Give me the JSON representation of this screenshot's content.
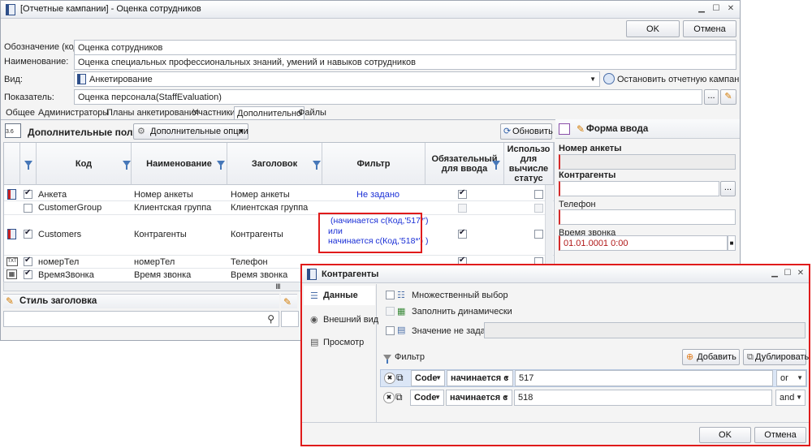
{
  "window": {
    "title": "[Отчетные кампании] - Оценка сотрудников",
    "ok": "OK",
    "cancel": "Отмена"
  },
  "form": {
    "code_label": "Обозначение (код):",
    "code_value": "Оценка сотрудников",
    "name_label": "Наименование:",
    "name_value": "Оценка специальных профессиональных знаний, умений и навыков сотрудников",
    "type_label": "Вид:",
    "type_value": "Анкетирование",
    "stop_label": "Остановить отчетную кампанию",
    "indicator_label": "Показатель:",
    "indicator_value": "Оценка персонала(StaffEvaluation)",
    "indicator_btn": "..."
  },
  "tabs": [
    "Общее",
    "Администраторы",
    "Планы анкетирования",
    "Участники",
    "Дополнительно",
    "Файлы"
  ],
  "fields_panel": {
    "title": "Дополнительные поля",
    "options": "Дополнительные опции",
    "refresh": "Обновить",
    "columns": [
      "Код",
      "Наименование",
      "Заголовок",
      "Фильтр",
      "Обязательный для ввода",
      "Использо для вычисле статус"
    ],
    "rows": [
      {
        "code": "Анкета",
        "name": "Номер анкеты",
        "caption": "Номер анкеты",
        "filter": "Не задано"
      },
      {
        "code": "CustomerGroup",
        "name": "Клиентская группа",
        "caption": "Клиентская группа",
        "filter": ""
      },
      {
        "code": "Customers",
        "name": "Контрагенты",
        "caption": "Контрагенты",
        "filter1": "(начинается с(Код,'517*')",
        "filter2": "или",
        "filter3": "начинается с(Код,'518*') )"
      },
      {
        "code": "номерТел",
        "name": "номерТел",
        "caption": "Телефон",
        "filter": ""
      },
      {
        "code": "ВремяЗвонка",
        "name": "Время звонка",
        "caption": "Время звонка",
        "filter": ""
      }
    ]
  },
  "style_panel": {
    "title": "Стиль заголовка"
  },
  "input_form": {
    "title": "Форма ввода",
    "f1": "Номер анкеты",
    "f2": "Контрагенты",
    "f2_btn": "...",
    "f3": "Телефон",
    "f4": "Время звонка",
    "f4_value": "01.01.0001 0:00"
  },
  "dialog": {
    "title": "Контрагенты",
    "nav": [
      "Данные",
      "Внешний вид",
      "Просмотр"
    ],
    "multi": "Множественный выбор",
    "dynamic": "Заполнить динамически",
    "not_set": "Значение не задано",
    "filter": "Фильтр",
    "add": "Добавить",
    "duplicate": "Дублировать",
    "rows": [
      {
        "field": "Code",
        "op": "начинается с",
        "value": "517",
        "logic": "or"
      },
      {
        "field": "Code",
        "op": "начинается с",
        "value": "518",
        "logic": "and"
      }
    ],
    "ok": "OK",
    "cancel": "Отмена"
  }
}
